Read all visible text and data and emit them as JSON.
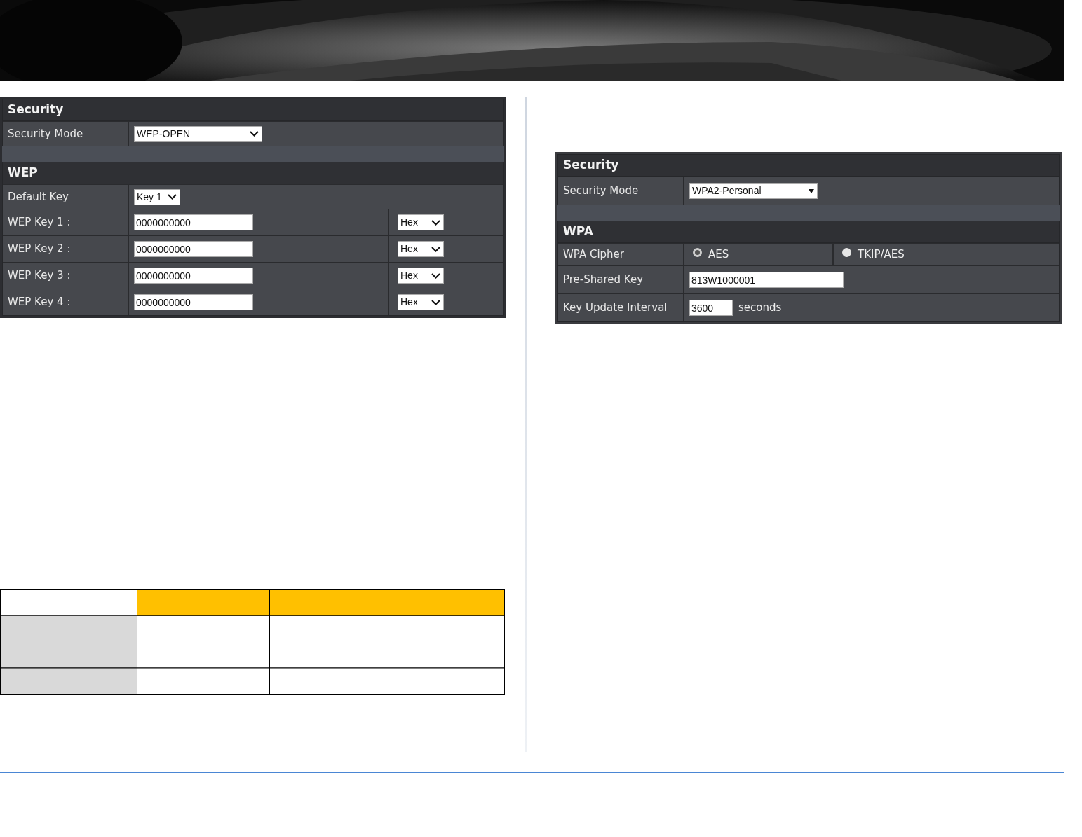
{
  "panels": [
    {
      "sections": [
        {
          "title": "Security",
          "rows": [
            {
              "label": "Security Mode",
              "cells": [
                [
                  {
                    "kind": "select",
                    "value": "WEP-OPEN"
                  }
                ]
              ]
            }
          ]
        },
        {
          "title": "WEP",
          "rows": [
            {
              "label": "Default Key",
              "cells": [
                [
                  {
                    "kind": "short_select",
                    "value": "Key 1"
                  }
                ]
              ]
            },
            {
              "label": "WEP Key 1 :",
              "cells": [
                [
                  {
                    "kind": "input",
                    "value": "0000000000"
                  }
                ],
                [
                  {
                    "kind": "short_select",
                    "value": "Hex"
                  }
                ]
              ]
            },
            {
              "label": "WEP Key 2 :",
              "cells": [
                [
                  {
                    "kind": "input",
                    "value": "0000000000"
                  }
                ],
                [
                  {
                    "kind": "short_select",
                    "value": "Hex"
                  }
                ]
              ]
            },
            {
              "label": "WEP Key 3 :",
              "cells": [
                [
                  {
                    "kind": "input",
                    "value": "0000000000"
                  }
                ],
                [
                  {
                    "kind": "short_select",
                    "value": "Hex"
                  }
                ]
              ]
            },
            {
              "label": "WEP Key 4 :",
              "cells": [
                [
                  {
                    "kind": "input",
                    "value": "0000000000"
                  }
                ],
                [
                  {
                    "kind": "short_select",
                    "value": "Hex"
                  }
                ]
              ]
            }
          ]
        }
      ]
    },
    {
      "sections": [
        {
          "title": "Security",
          "rows": [
            {
              "label": "Security Mode",
              "cells": [
                [
                  {
                    "kind": "triangle_select",
                    "value": "WPA2-Personal"
                  }
                ]
              ]
            }
          ]
        },
        {
          "title": "WPA",
          "rows": [
            {
              "label": "WPA Cipher",
              "cells": [
                [
                  {
                    "kind": "radio",
                    "label": "AES",
                    "selected": true
                  }
                ],
                [
                  {
                    "kind": "radio",
                    "label": "TKIP/AES",
                    "selected": false
                  }
                ]
              ]
            },
            {
              "label": "Pre-Shared Key",
              "cells": [
                [
                  {
                    "kind": "long_input",
                    "value": "813W1000001"
                  }
                ]
              ]
            },
            {
              "label": "Key Update Interval",
              "cells": [
                [
                  {
                    "kind": "short_input",
                    "value": "3600"
                  },
                  {
                    "kind": "text",
                    "text": "seconds"
                  }
                ]
              ]
            }
          ]
        }
      ]
    }
  ],
  "table": {
    "rows": [
      {
        "cells": [
          {
            "kind": "blank"
          },
          {
            "kind": "header"
          },
          {
            "kind": "header"
          }
        ]
      },
      {
        "cells": [
          {
            "kind": "label"
          },
          {
            "kind": "blank"
          },
          {
            "kind": "blank"
          }
        ]
      },
      {
        "cells": [
          {
            "kind": "label"
          },
          {
            "kind": "blank"
          },
          {
            "kind": "blank"
          }
        ]
      },
      {
        "cells": [
          {
            "kind": "label"
          },
          {
            "kind": "blank"
          },
          {
            "kind": "blank"
          }
        ]
      }
    ]
  }
}
